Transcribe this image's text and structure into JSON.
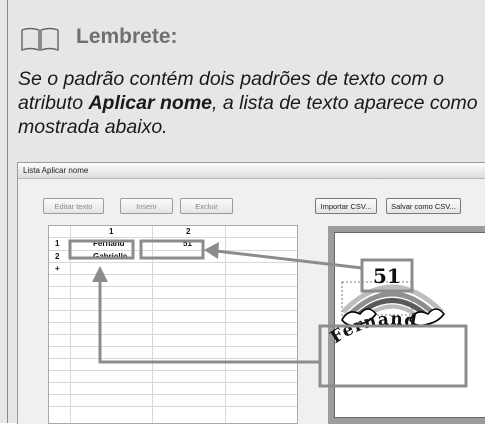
{
  "memo": {
    "title": "Lembrete:",
    "text_part1": "Se o padrão contém dois padrões de texto com o atributo ",
    "text_bold": "Aplicar nome",
    "text_part2": ", a lista de texto aparece como mostrada abaixo."
  },
  "window": {
    "title": "Lista Aplicar nome",
    "buttons": {
      "edit": "Editar texto",
      "insert": "Inserir",
      "delete": "Excluir",
      "import": "Importar CSV...",
      "save": "Salvar como CSV..."
    }
  },
  "grid": {
    "columns": [
      "1",
      "2"
    ],
    "rows": [
      {
        "num": "1",
        "col1": "Fernand",
        "col2": "51"
      },
      {
        "num": "2",
        "col1": "Gabrielle",
        "col2": ""
      },
      {
        "num": "+",
        "col1": "",
        "col2": ""
      }
    ]
  },
  "preview": {
    "number_text": "51",
    "arc_text": "Fernand"
  },
  "colors": {
    "callout_gray": "#8c8c8c",
    "panel_gray": "#e6e6e6"
  },
  "icons": [
    "book-icon",
    "arrow-icon"
  ]
}
